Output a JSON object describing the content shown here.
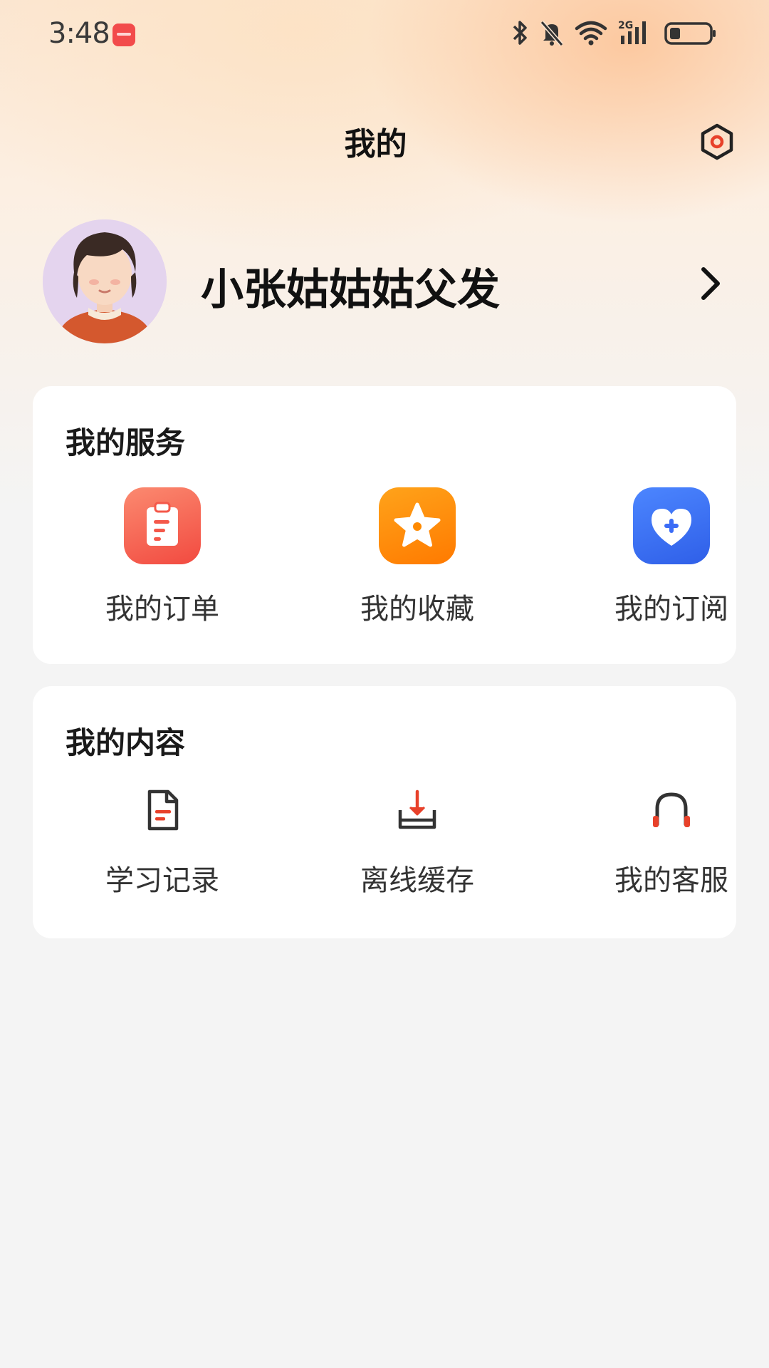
{
  "status_bar": {
    "time": "3:48",
    "network": "2G",
    "icons": [
      "bluetooth-icon",
      "mute-bell-icon",
      "wifi-icon",
      "cellular-signal-icon",
      "battery-icon"
    ]
  },
  "header": {
    "title": "我的",
    "settings_icon": "settings-gear-icon"
  },
  "profile": {
    "username": "小张姑姑姑父发",
    "avatar": "user-avatar",
    "arrow_icon": "chevron-right-icon"
  },
  "services": {
    "title": "我的服务",
    "items": [
      {
        "label": "我的订单",
        "icon": "clipboard-icon",
        "color": "#f4584a"
      },
      {
        "label": "我的收藏",
        "icon": "star-icon",
        "color": "#ff8a00"
      },
      {
        "label": "我的订阅",
        "icon": "heart-plus-icon",
        "color": "#3b6cf6"
      }
    ]
  },
  "content": {
    "title": "我的内容",
    "items": [
      {
        "label": "学习记录",
        "icon": "document-icon"
      },
      {
        "label": "离线缓存",
        "icon": "download-icon"
      },
      {
        "label": "我的客服",
        "icon": "headset-icon"
      }
    ]
  },
  "colors": {
    "accent": "#e8412a",
    "text": "#333333"
  }
}
